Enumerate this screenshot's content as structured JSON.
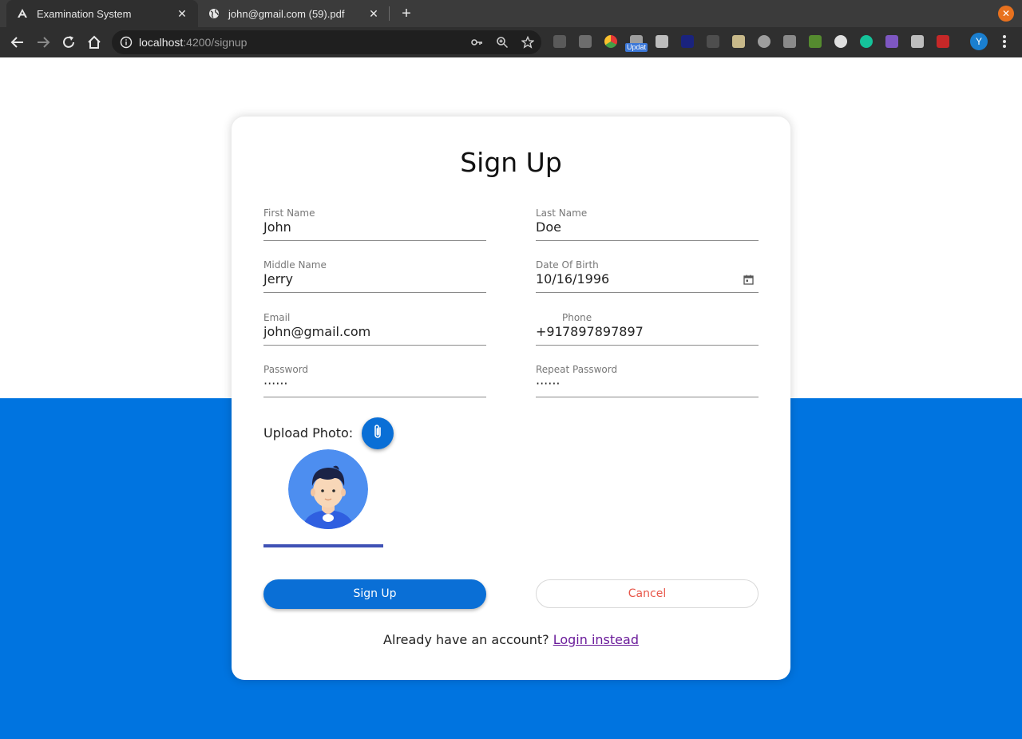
{
  "browser": {
    "tabs": [
      {
        "title": "Examination System",
        "active": true
      },
      {
        "title": "john@gmail.com (59).pdf",
        "active": false
      }
    ],
    "url_host": "localhost",
    "url_rest": ":4200/signup",
    "update_badge": "Updat",
    "profile_initial": "Y",
    "accent_color": "#0074e0"
  },
  "form": {
    "title": "Sign Up",
    "first_name": {
      "label": "First Name",
      "value": "John"
    },
    "last_name": {
      "label": "Last Name",
      "value": "Doe"
    },
    "middle_name": {
      "label": "Middle Name",
      "value": "Jerry"
    },
    "dob": {
      "label": "Date Of Birth",
      "value": "10/16/1996"
    },
    "email": {
      "label": "Email",
      "value": "john@gmail.com"
    },
    "phone": {
      "label": "Phone",
      "prefix": "+91",
      "value": "7897897897"
    },
    "password": {
      "label": "Password",
      "value": "······"
    },
    "repeat_password": {
      "label": "Repeat Password",
      "value": "······"
    },
    "upload_label": "Upload Photo:",
    "signup_label": "Sign Up",
    "cancel_label": "Cancel",
    "login_prompt": "Already have an account?",
    "login_link": "Login instead"
  }
}
